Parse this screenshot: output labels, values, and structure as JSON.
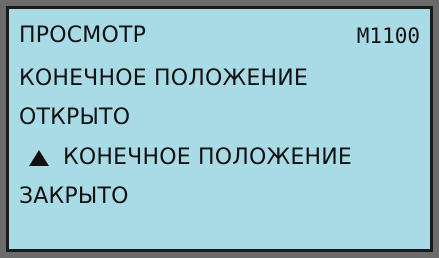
{
  "display": {
    "header_title": "ПРОСМОТР",
    "menu_code": "M1100",
    "line_1": "КОНЕЧНОЕ  ПОЛОЖЕНИЕ",
    "line_2": "ОТКРЫТО",
    "line_3": "КОНЕЧНОЕ  ПОЛОЖЕНИЕ",
    "line_4": "ЗАКРЫТО"
  },
  "icons": {
    "selection_marker": "triangle-up-icon"
  },
  "colors": {
    "screen_background": "#a9dbe6",
    "text": "#111111",
    "bezel": "#6b6b6b"
  }
}
